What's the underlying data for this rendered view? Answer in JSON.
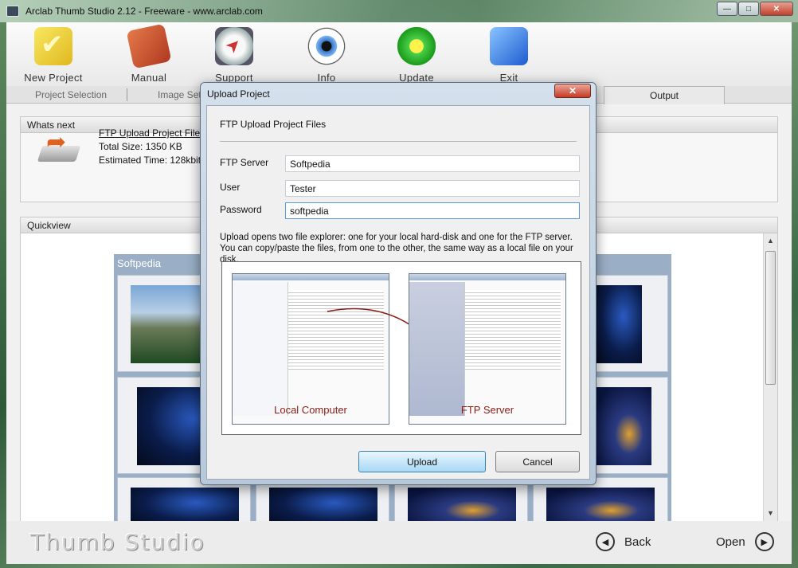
{
  "window": {
    "title": "Arclab Thumb Studio 2.12 - Freeware - www.arclab.com",
    "controls": {
      "minimize": "—",
      "maximize": "□",
      "close": "✕"
    }
  },
  "toolbar": {
    "items": [
      {
        "label": "New Project",
        "icon": "checkmark-folder-icon"
      },
      {
        "label": "Manual",
        "icon": "book-icon"
      },
      {
        "label": "Support",
        "icon": "compass-icon"
      },
      {
        "label": "Info",
        "icon": "eye-icon"
      },
      {
        "label": "Update",
        "icon": "flower-icon"
      },
      {
        "label": "Exit",
        "icon": "arrow-exit-icon"
      }
    ]
  },
  "tabs": {
    "items": [
      "Project Selection",
      "Image Sett",
      "Output"
    ],
    "active": "Output"
  },
  "whats_next": {
    "header": "Whats next",
    "link": "FTP Upload Project Files",
    "total_size": "Total Size:  1350 KB",
    "estimated_time": "Estimated Time:  128kbit>1"
  },
  "quickview": {
    "header": "Quickview",
    "gallery_title": "Softpedia"
  },
  "footer": {
    "brand": "Thumb Studio",
    "back": "Back",
    "open": "Open"
  },
  "dialog": {
    "title": "Upload Project",
    "close": "✕",
    "heading": "FTP Upload Project Files",
    "fields": {
      "server_label": "FTP Server",
      "server_value": "Softpedia",
      "user_label": "User",
      "user_value": "Tester",
      "password_label": "Password",
      "password_value": "softpedia"
    },
    "description": "Upload opens two file explorer: one for your local hard-disk and one for the FTP server. You can copy/paste the files, from one to the other, the same way as a local file on your disk.",
    "preview": {
      "local_label": "Local Computer",
      "ftp_label": "FTP Server"
    },
    "upload_button": "Upload",
    "cancel_button": "Cancel"
  },
  "colors": {
    "accent_button": "#a7d9f5",
    "dialog_frame": "#b7c8da",
    "gallery_bg": "#9aafc6",
    "preview_label": "#8a1c14"
  }
}
